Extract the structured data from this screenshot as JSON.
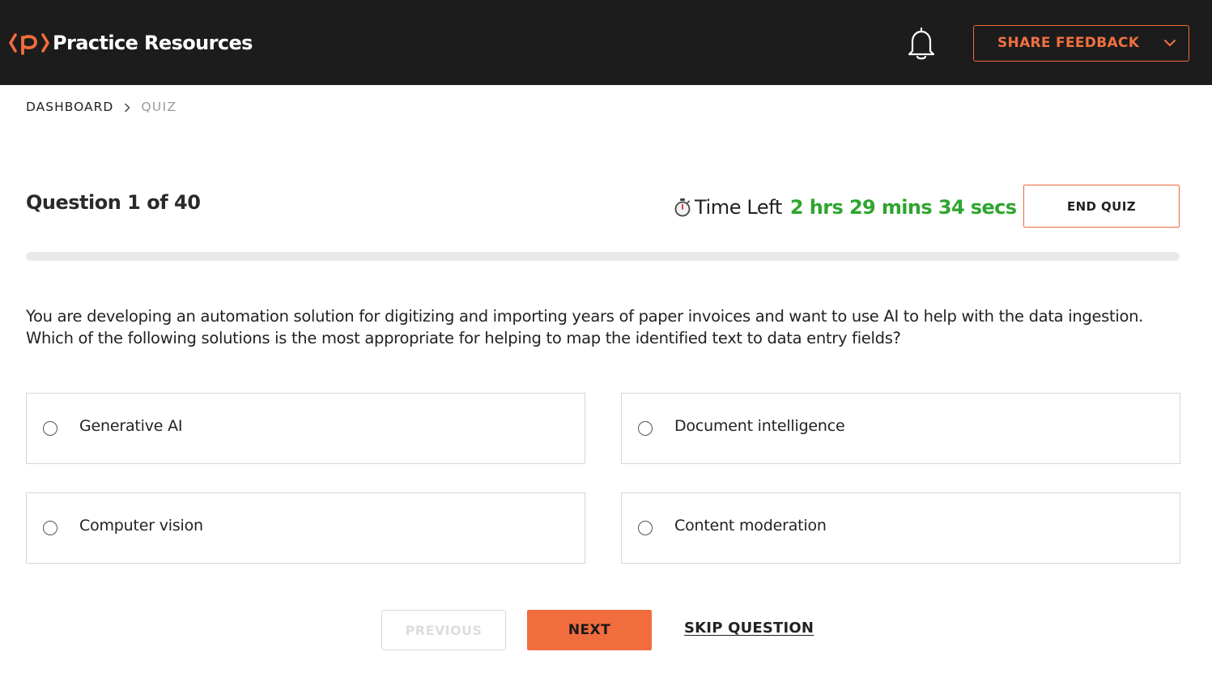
{
  "header": {
    "brand_name": "Practice Resources",
    "feedback_label": "SHARE FEEDBACK",
    "accent_color": "#ee6a3a"
  },
  "breadcrumb": {
    "home": "DASHBOARD",
    "current": "QUIZ"
  },
  "quiz": {
    "counter": "Question 1 of 40",
    "progress_fraction": 0,
    "timer_label": "Time Left",
    "timer_value": "2 hrs 29 mins 34 secs",
    "timer_color": "#2fa52f",
    "end_label": "END QUIZ",
    "question_text": "You are developing an automation solution for digitizing and importing years of paper invoices and want to use AI to help with the data ingestion. Which of the following solutions is the most appropriate for helping to map the identified text to data entry fields?",
    "options": [
      {
        "label": "Generative AI",
        "selected": false
      },
      {
        "label": "Document intelligence",
        "selected": false
      },
      {
        "label": "Computer vision",
        "selected": false
      },
      {
        "label": "Content moderation",
        "selected": false
      }
    ]
  },
  "nav": {
    "previous_label": "PREVIOUS",
    "previous_disabled": true,
    "next_label": "NEXT",
    "skip_label": "SKIP QUESTION"
  },
  "icons": [
    "packt-logo-icon",
    "bell-icon",
    "chevron-down-icon",
    "chevron-right-icon",
    "stopwatch-icon",
    "radio-icon"
  ]
}
